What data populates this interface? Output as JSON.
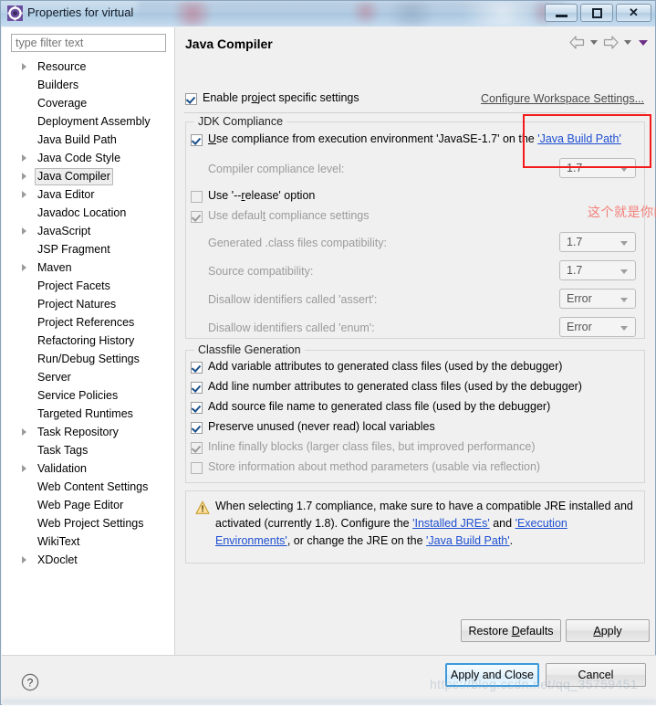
{
  "window": {
    "title": "Properties for virtual",
    "icon": "eclipse-properties-icon",
    "minimize_label": "Minimize",
    "maximize_label": "Maximize",
    "close_label": "Close"
  },
  "sidebar": {
    "filter": {
      "placeholder": "type filter text",
      "value": ""
    },
    "items": [
      {
        "label": "Resource",
        "expandable": true,
        "selected": false
      },
      {
        "label": "Builders",
        "expandable": false,
        "selected": false
      },
      {
        "label": "Coverage",
        "expandable": false,
        "selected": false
      },
      {
        "label": "Deployment Assembly",
        "expandable": false,
        "selected": false
      },
      {
        "label": "Java Build Path",
        "expandable": false,
        "selected": false
      },
      {
        "label": "Java Code Style",
        "expandable": true,
        "selected": false
      },
      {
        "label": "Java Compiler",
        "expandable": true,
        "selected": true
      },
      {
        "label": "Java Editor",
        "expandable": true,
        "selected": false
      },
      {
        "label": "Javadoc Location",
        "expandable": false,
        "selected": false
      },
      {
        "label": "JavaScript",
        "expandable": true,
        "selected": false
      },
      {
        "label": "JSP Fragment",
        "expandable": false,
        "selected": false
      },
      {
        "label": "Maven",
        "expandable": true,
        "selected": false
      },
      {
        "label": "Project Facets",
        "expandable": false,
        "selected": false
      },
      {
        "label": "Project Natures",
        "expandable": false,
        "selected": false
      },
      {
        "label": "Project References",
        "expandable": false,
        "selected": false
      },
      {
        "label": "Refactoring History",
        "expandable": false,
        "selected": false
      },
      {
        "label": "Run/Debug Settings",
        "expandable": false,
        "selected": false
      },
      {
        "label": "Server",
        "expandable": false,
        "selected": false
      },
      {
        "label": "Service Policies",
        "expandable": false,
        "selected": false
      },
      {
        "label": "Targeted Runtimes",
        "expandable": false,
        "selected": false
      },
      {
        "label": "Task Repository",
        "expandable": true,
        "selected": false
      },
      {
        "label": "Task Tags",
        "expandable": false,
        "selected": false
      },
      {
        "label": "Validation",
        "expandable": true,
        "selected": false
      },
      {
        "label": "Web Content Settings",
        "expandable": false,
        "selected": false
      },
      {
        "label": "Web Page Editor",
        "expandable": false,
        "selected": false
      },
      {
        "label": "Web Project Settings",
        "expandable": false,
        "selected": false
      },
      {
        "label": "WikiText",
        "expandable": false,
        "selected": false
      },
      {
        "label": "XDoclet",
        "expandable": true,
        "selected": false
      }
    ]
  },
  "page": {
    "title": "Java Compiler",
    "nav": {
      "back_label": "Back",
      "forward_label": "Forward",
      "menu_label": "View Menu"
    },
    "enable_specific": {
      "label": "Enable project specific settings",
      "checked": true
    },
    "workspace_link": "Configure Workspace Settings..."
  },
  "jdk_compliance": {
    "group_title": "JDK Compliance",
    "use_execution_env": {
      "text_before": "Use compliance from execution environment 'JavaSE-1.7' on the ",
      "link": "'Java Build Path'",
      "checked": true
    },
    "rows": [
      {
        "label": "Compiler compliance level:",
        "value": "1.7",
        "disabled": true
      },
      {
        "label": "Generated .class files compatibility:",
        "value": "1.7",
        "disabled": true
      },
      {
        "label": "Source compatibility:",
        "value": "1.7",
        "disabled": true
      },
      {
        "label": "Disallow identifiers called 'assert':",
        "value": "Error",
        "disabled": true
      },
      {
        "label": "Disallow identifiers called 'enum':",
        "value": "Error",
        "disabled": true
      }
    ],
    "use_release_option": {
      "label": "Use '--release' option",
      "checked": false,
      "disabled": true
    },
    "use_default_compliance": {
      "label": "Use default compliance settings",
      "checked": true,
      "disabled": true
    }
  },
  "classfile_generation": {
    "group_title": "Classfile Generation",
    "options": [
      {
        "label": "Add variable attributes to generated class files (used by the debugger)",
        "checked": true,
        "disabled": false
      },
      {
        "label": "Add line number attributes to generated class files (used by the debugger)",
        "checked": true,
        "disabled": false
      },
      {
        "label": "Add source file name to generated class file (used by the debugger)",
        "checked": true,
        "disabled": false
      },
      {
        "label": "Preserve unused (never read) local variables",
        "checked": true,
        "disabled": false
      },
      {
        "label": "Inline finally blocks (larger class files, but improved performance)",
        "checked": true,
        "disabled": true
      },
      {
        "label": "Store information about method parameters (usable via reflection)",
        "checked": false,
        "disabled": true
      }
    ]
  },
  "warning": {
    "icon": "warning-triangle-icon",
    "part1": "When selecting 1.7 compliance, make sure to have a compatible JRE installed and activated (currently 1.8). Configure the ",
    "link1": "'Installed JREs'",
    "part2": " and ",
    "link2": "'Execution Environments'",
    "part3": ", or change the JRE on the ",
    "link3": "'Java Build Path'",
    "part4": "."
  },
  "buttons": {
    "restore_defaults": "Restore Defaults",
    "apply": "Apply",
    "apply_and_close": "Apply and Close",
    "cancel": "Cancel",
    "help_icon": "help-question-icon"
  },
  "annotations": {
    "chinese_note": "这个就是你的开发编译器的版本号",
    "note_color": "#f2807a",
    "highlight_box_color": "#f41a1a"
  },
  "watermark": "https://blog.csdn.net/qq_35759451"
}
